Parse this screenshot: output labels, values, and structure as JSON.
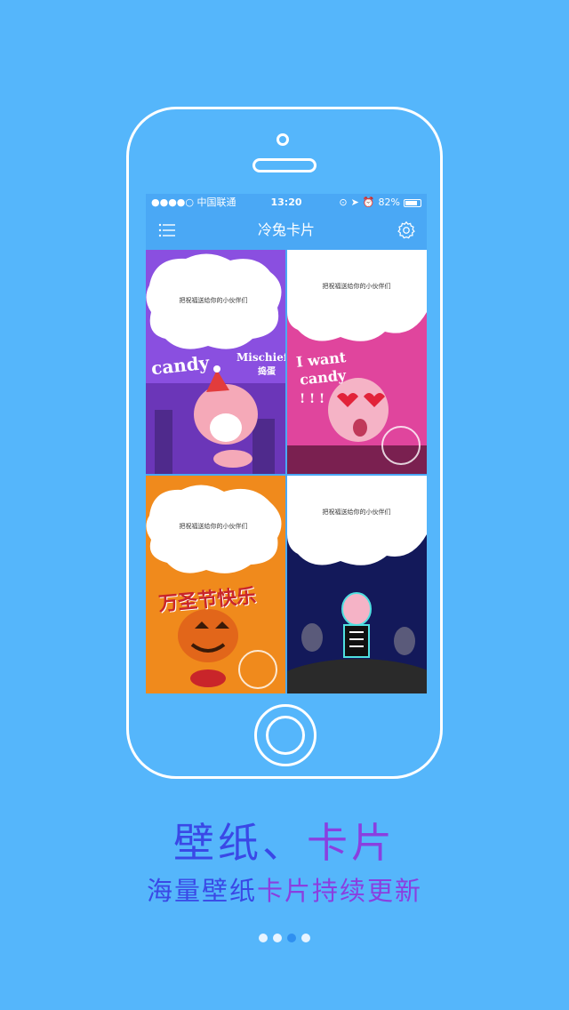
{
  "status_bar": {
    "carrier": "●●●●○ 中国联通",
    "time": "13:20",
    "battery": "82%",
    "battery_level": 0.82
  },
  "nav": {
    "title": "冷兔卡片",
    "menu_icon": "list-icon",
    "settings_icon": "gear-icon"
  },
  "cards": [
    {
      "cloud_text": "把祝福送给你的小伙伴们",
      "art_text": "candy",
      "art_text2": "Mischief",
      "art_text3": "捣蛋",
      "bg": "#8a4fe0"
    },
    {
      "cloud_text": "把祝福送给你的小伙伴们",
      "art_text": "I want",
      "art_text2": "candy",
      "art_text3": "! ! !",
      "bg": "#e0459d"
    },
    {
      "cloud_text": "把祝福送给你的小伙伴们",
      "art_text": "万圣节快乐",
      "bg": "#f08a1c"
    },
    {
      "cloud_text": "把祝福送给你的小伙伴们",
      "bg": "#13195a"
    }
  ],
  "headline": {
    "part1": "壁纸、",
    "part2": "卡片"
  },
  "subline": {
    "part1": "海量壁纸",
    "part2": "卡片持续更新"
  },
  "pager": {
    "count": 4,
    "active_index": 2
  },
  "colors": {
    "background": "#55b6fb",
    "navbar": "#4aa8f5",
    "headline_blue": "#3a48e6",
    "headline_purple": "#8a3fe0"
  }
}
